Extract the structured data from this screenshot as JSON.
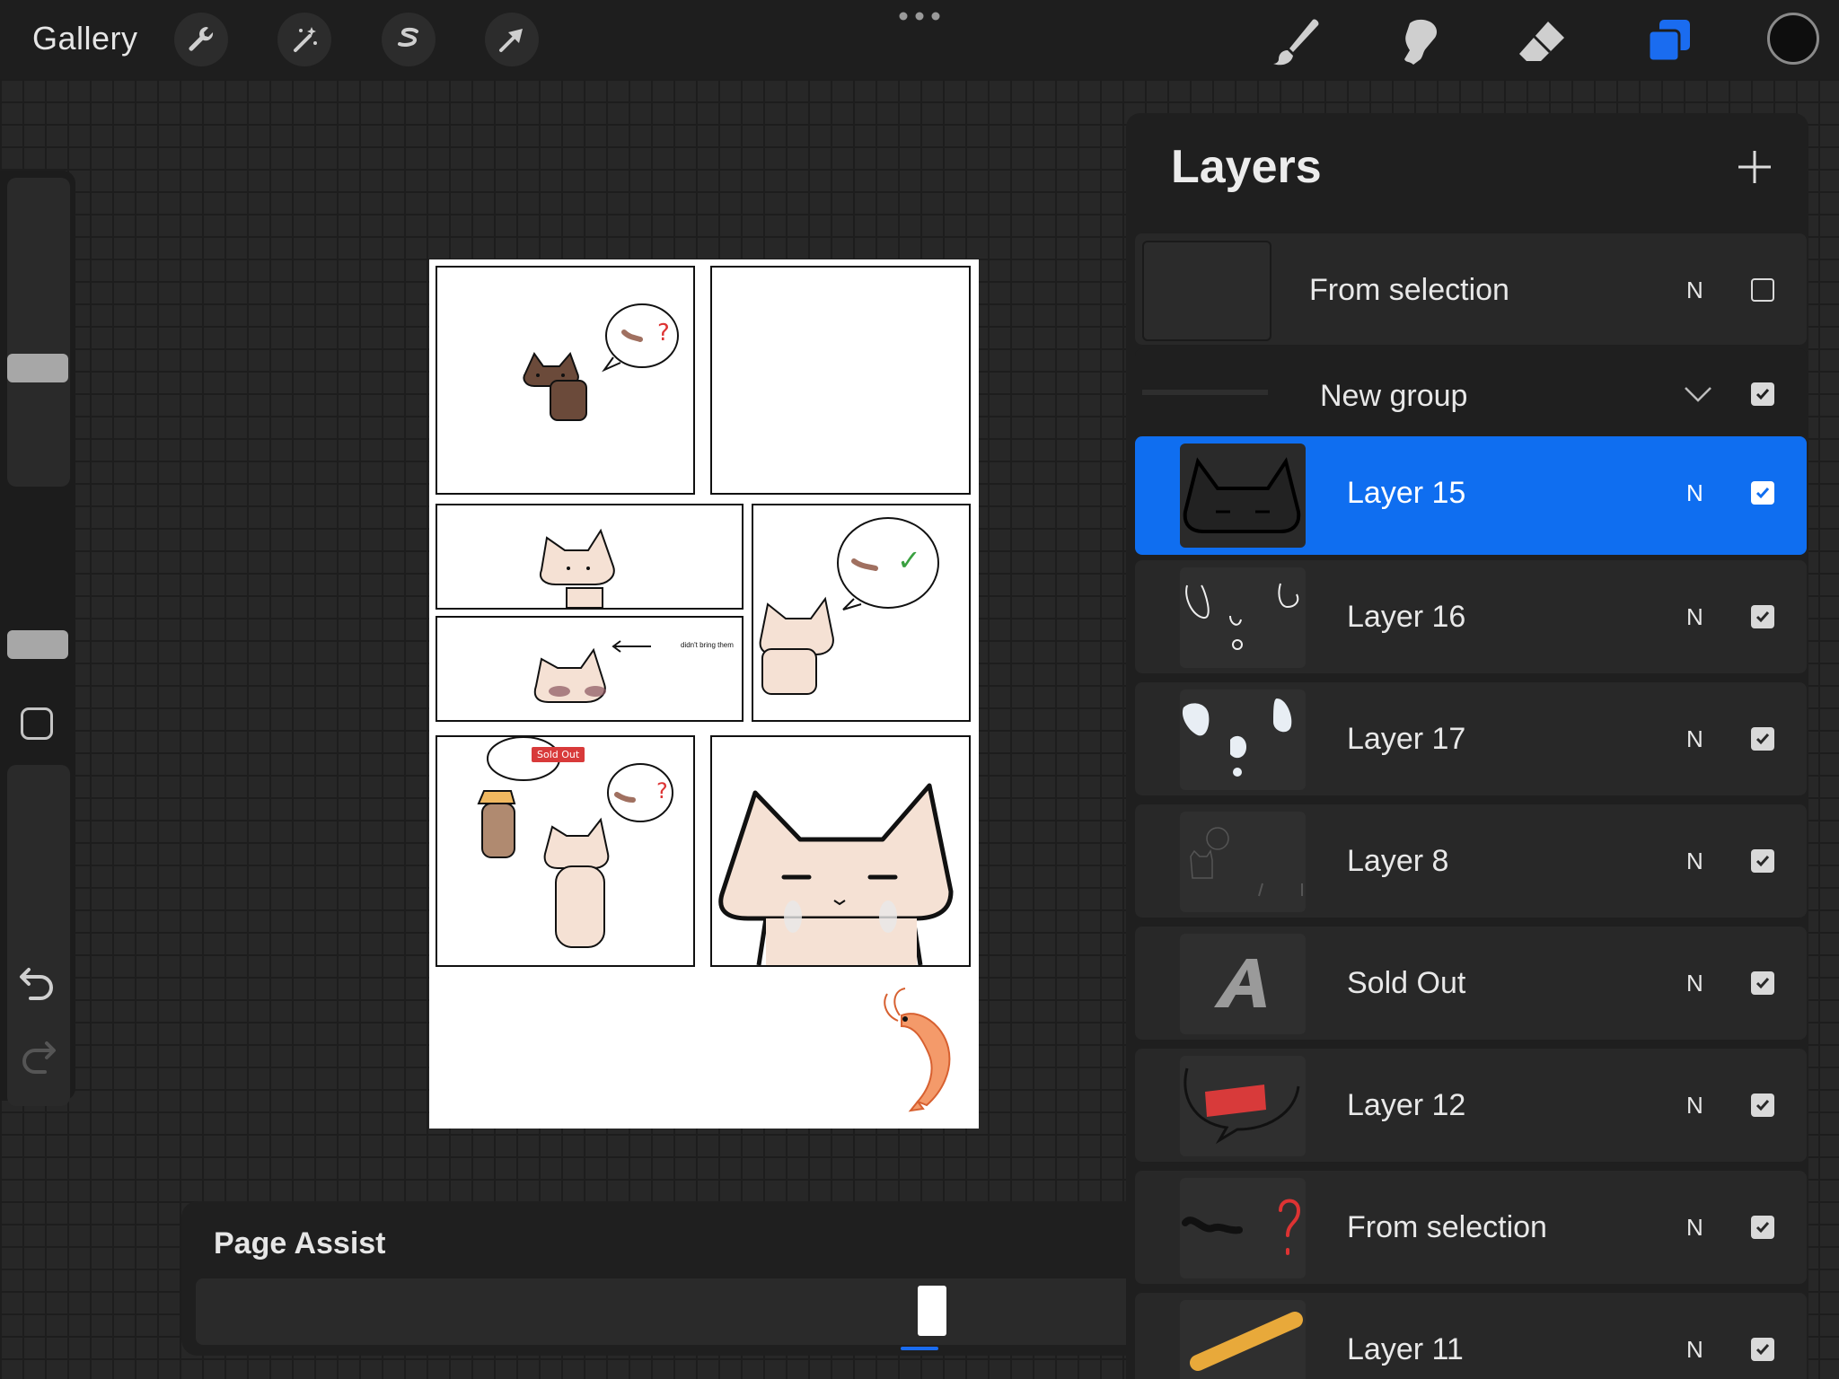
{
  "toolbar": {
    "gallery_label": "Gallery",
    "tools": [
      "wrench-icon",
      "magic-wand-icon",
      "selection-icon",
      "transform-arrow-icon"
    ],
    "right_tools": [
      "brush-icon",
      "smudge-icon",
      "eraser-icon",
      "layers-icon"
    ],
    "accent_color": "#1a6cf0",
    "current_color": "#0e0e0e"
  },
  "artwork": {
    "speech_sold_out": "Sold Out",
    "caption_text": "didn't bring them",
    "question_mark": "?",
    "check_mark": "✓"
  },
  "page_assist": {
    "title": "Page Assist"
  },
  "layers": {
    "title": "Layers",
    "items": [
      {
        "name": "From selection",
        "mode": "N",
        "visible": false,
        "selected": false
      },
      {
        "name": "New group",
        "mode": "",
        "visible": true,
        "selected": false,
        "is_group": true
      },
      {
        "name": "Layer 15",
        "mode": "N",
        "visible": true,
        "selected": true
      },
      {
        "name": "Layer 16",
        "mode": "N",
        "visible": true,
        "selected": false
      },
      {
        "name": "Layer 17",
        "mode": "N",
        "visible": true,
        "selected": false
      },
      {
        "name": "Layer 8",
        "mode": "N",
        "visible": true,
        "selected": false
      },
      {
        "name": "Sold Out",
        "mode": "N",
        "visible": true,
        "selected": false
      },
      {
        "name": "Layer 12",
        "mode": "N",
        "visible": true,
        "selected": false
      },
      {
        "name": "From selection",
        "mode": "N",
        "visible": true,
        "selected": false
      },
      {
        "name": "Layer 11",
        "mode": "N",
        "visible": true,
        "selected": false
      }
    ]
  }
}
